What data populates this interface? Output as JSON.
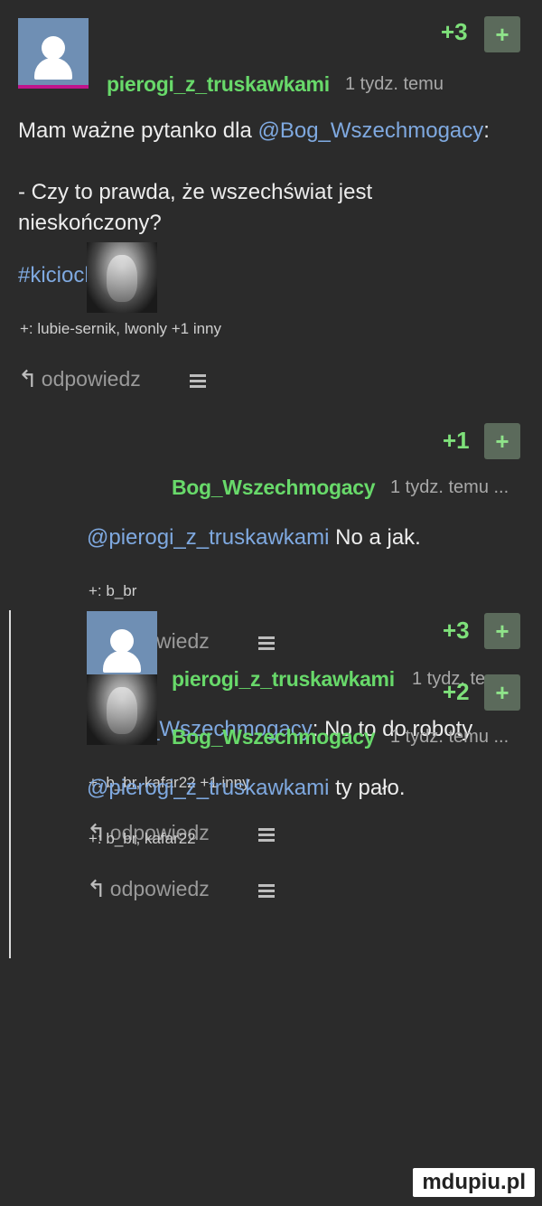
{
  "comments": [
    {
      "author": "pierogi_z_truskawkami",
      "time": "1 tydz. temu",
      "votes": "+3",
      "plus": "+",
      "text_intro": "Mam ważne pytanko dla ",
      "mention": "@Bog_Wszechmogacy",
      "text_colon": ":",
      "question_line1": "- Czy to prawda, że wszechświat jest",
      "question_line2": "nieskończony?",
      "hashtag": "#kiciochpyta",
      "likes": "+: lubie-sernik, lwonly +1 inny",
      "reply": "odpowiedz"
    },
    {
      "author": "Bog_Wszechmogacy",
      "time": "1 tydz. temu ...",
      "votes": "+1",
      "plus": "+",
      "mention": "@pierogi_z_truskawkami",
      "text": " No a jak.",
      "likes": "+: b_br",
      "reply": "odpowiedz"
    },
    {
      "author": "pierogi_z_truskawkami",
      "time": "1 tydz. te...",
      "votes": "+3",
      "plus": "+",
      "mention": "@Bog_Wszechmogacy",
      "text": ": No to do roboty",
      "likes": "+: b_br, kafar22 +1 inny",
      "reply": "odpowiedz"
    },
    {
      "author": "Bog_Wszechmogacy",
      "time": "1 tydz. temu ...",
      "votes": "+2",
      "plus": "+",
      "mention": "@pierogi_z_truskawkami",
      "text": " ty pało.",
      "likes": "+: b_br, kafar22",
      "reply": "odpowiedz"
    }
  ],
  "watermark": "mdupiu.pl",
  "icons": {
    "reply": "reply-arrow-icon",
    "menu": "menu-lines-icon",
    "avatar_default": "default-avatar-icon",
    "avatar_bog": "bearded-man-avatar"
  },
  "colors": {
    "author": "#68d96a",
    "mention": "#7fa9e0",
    "vote": "#7ee07a",
    "background": "#2b2b2b"
  }
}
